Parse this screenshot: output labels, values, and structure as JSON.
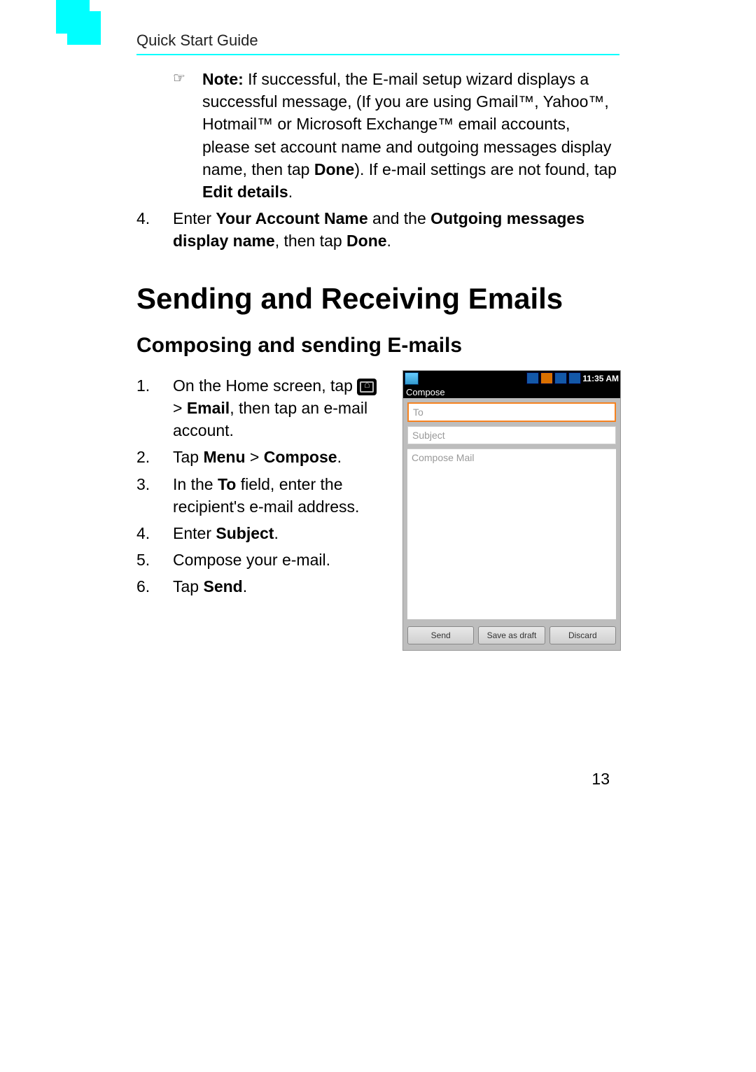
{
  "header": {
    "title": "Quick Start Guide"
  },
  "note": {
    "label": "Note:",
    "text_1": " If successful, the E-mail setup wizard displays a successful message, (If you are using Gmail™, Yahoo™, Hotmail™ or Microsoft Exchange™ email accounts, please set account name and outgoing messages display name, then tap ",
    "bold_1": "Done",
    "text_2": "). If e-mail settings are not found, tap ",
    "bold_2": "Edit details",
    "text_3": "."
  },
  "step4top": {
    "num": "4.",
    "t1": "Enter ",
    "b1": "Your Account Name",
    "t2": " and the ",
    "b2": "Outgoing messages display name",
    "t3": ", then tap ",
    "b3": "Done",
    "t4": "."
  },
  "section_title": "Sending and Receiving Emails",
  "subsection_title": "Composing and sending E-mails",
  "steps": {
    "s1": {
      "num": "1.",
      "t1": "On the Home screen, tap ",
      "t2": " > ",
      "b1": "Email",
      "t3": ", then tap an e-mail account."
    },
    "s2": {
      "num": "2.",
      "t1": "Tap ",
      "b1": "Menu",
      "t2": " > ",
      "b2": "Compose",
      "t3": "."
    },
    "s3": {
      "num": "3.",
      "t1": "In the ",
      "b1": "To",
      "t2": " field, enter the recipient's e-mail address."
    },
    "s4": {
      "num": "4.",
      "t1": "Enter ",
      "b1": "Subject",
      "t2": "."
    },
    "s5": {
      "num": "5.",
      "t1": "Compose your e-mail."
    },
    "s6": {
      "num": "6.",
      "t1": "Tap ",
      "b1": "Send",
      "t2": "."
    }
  },
  "screenshot": {
    "time": "11:35 AM",
    "compose_label": "Compose",
    "to_placeholder": "To",
    "subject_placeholder": "Subject",
    "body_placeholder": "Compose Mail",
    "buttons": {
      "send": "Send",
      "draft": "Save as draft",
      "discard": "Discard"
    }
  },
  "page_number": "13"
}
